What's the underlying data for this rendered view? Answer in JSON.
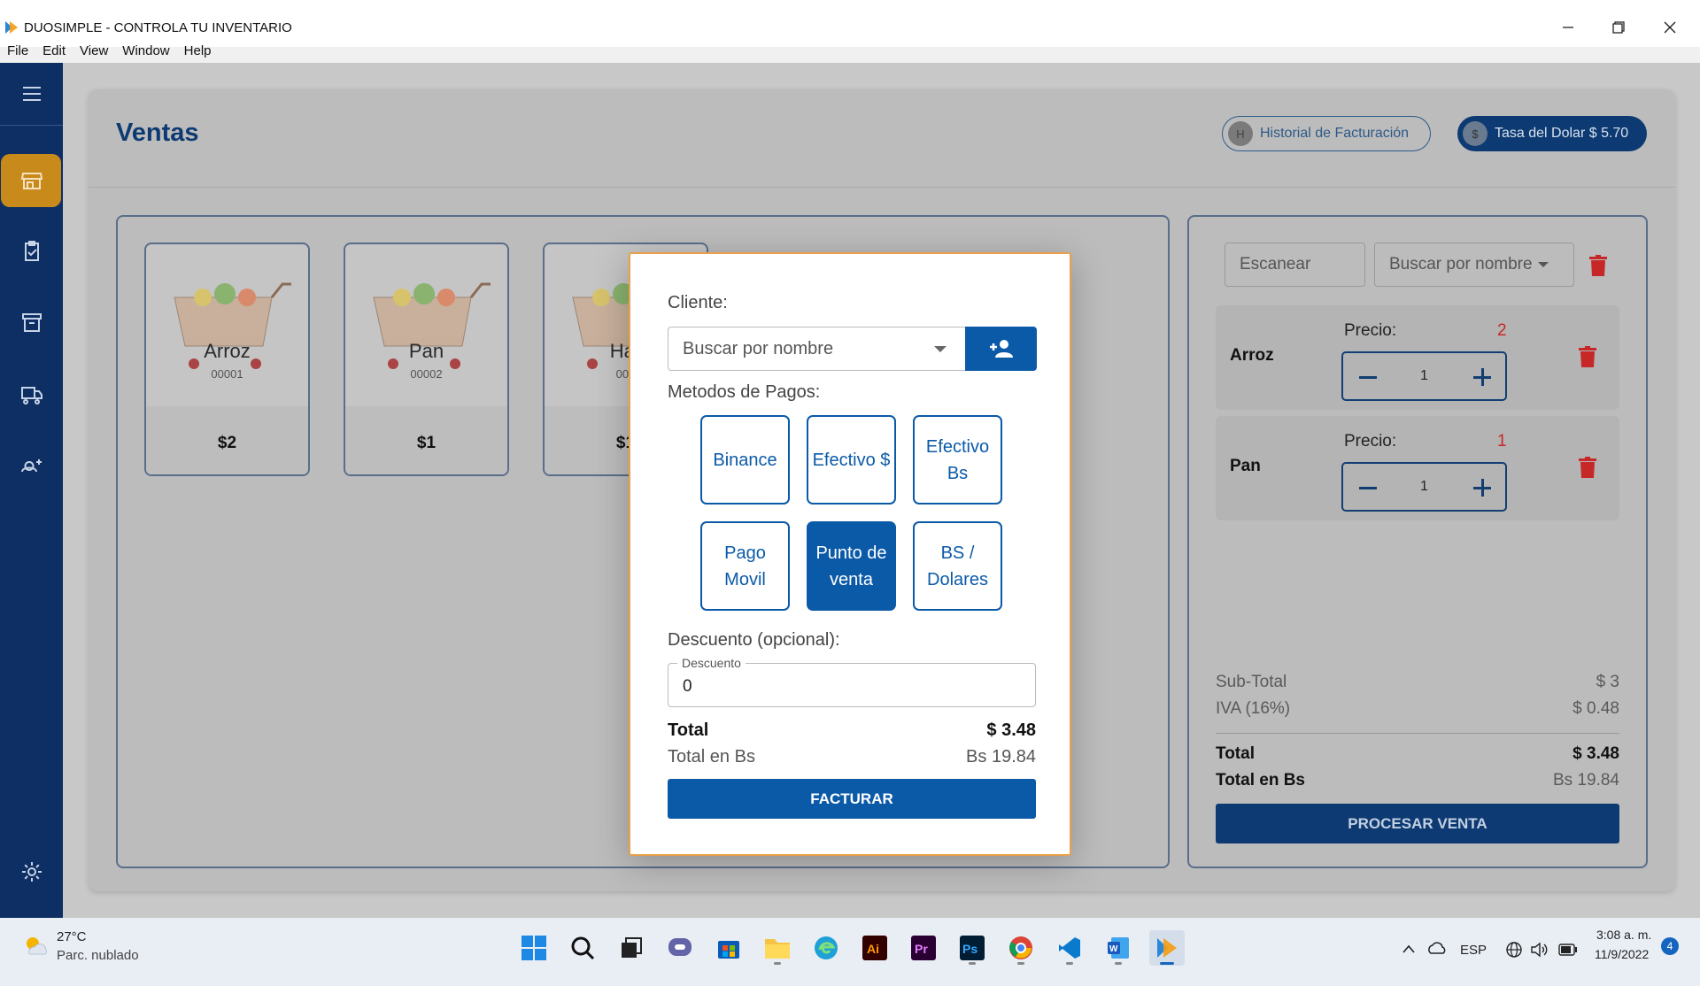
{
  "window": {
    "title": "DUOSIMPLE - CONTROLA TU INVENTARIO",
    "menu": [
      "File",
      "Edit",
      "View",
      "Window",
      "Help"
    ]
  },
  "page": {
    "title": "Ventas",
    "history_button": "Historial de Facturación",
    "history_badge": "H",
    "rate_chip": "Tasa del Dolar $ 5.70",
    "rate_badge": "$"
  },
  "products": [
    {
      "name": "Arroz",
      "code": "00001",
      "price": "$2"
    },
    {
      "name": "Pan",
      "code": "00002",
      "price": "$1"
    },
    {
      "name": "Har",
      "code": "000",
      "price": "$1"
    }
  ],
  "cart": {
    "scan_placeholder": "Escanear",
    "search_placeholder": "Buscar por nombre",
    "price_label": "Precio:",
    "items": [
      {
        "name": "Arroz",
        "price_value": "2",
        "qty": "1"
      },
      {
        "name": "Pan",
        "price_value": "1",
        "qty": "1"
      }
    ],
    "subtotal_label": "Sub-Total",
    "subtotal_value": "$ 3",
    "iva_label": "IVA (16%)",
    "iva_value": "$ 0.48",
    "total_label": "Total",
    "total_value": "$ 3.48",
    "total_bs_label": "Total en Bs",
    "total_bs_value": "Bs 19.84",
    "process_button": "PROCESAR VENTA"
  },
  "modal": {
    "client_label": "Cliente:",
    "client_placeholder": "Buscar por nombre",
    "payment_label": "Metodos de Pagos:",
    "payments": [
      {
        "label": "Binance",
        "selected": false
      },
      {
        "label": "Efectivo $",
        "selected": false
      },
      {
        "label": "Efectivo Bs",
        "selected": false
      },
      {
        "label": "Pago Movil",
        "selected": false
      },
      {
        "label": "Punto de venta",
        "selected": true
      },
      {
        "label": "BS / Dolares",
        "selected": false
      }
    ],
    "discount_label": "Descuento (opcional):",
    "discount_field_label": "Descuento",
    "discount_value": "0",
    "total_label": "Total",
    "total_value": "$ 3.48",
    "total_bs_label": "Total en Bs",
    "total_bs_value": "Bs 19.84",
    "invoice_button": "FACTURAR"
  },
  "taskbar": {
    "temperature": "27°C",
    "weather": "Parc. nublado",
    "language": "ESP",
    "time": "3:08 a. m.",
    "date": "11/9/2022",
    "notifications": "4"
  },
  "colors": {
    "sidebar": "#0d2f63",
    "accent": "#0b5aa8",
    "active_nav": "#c98a1c",
    "modal_border": "#e8a04a",
    "price_red": "#c62828"
  }
}
